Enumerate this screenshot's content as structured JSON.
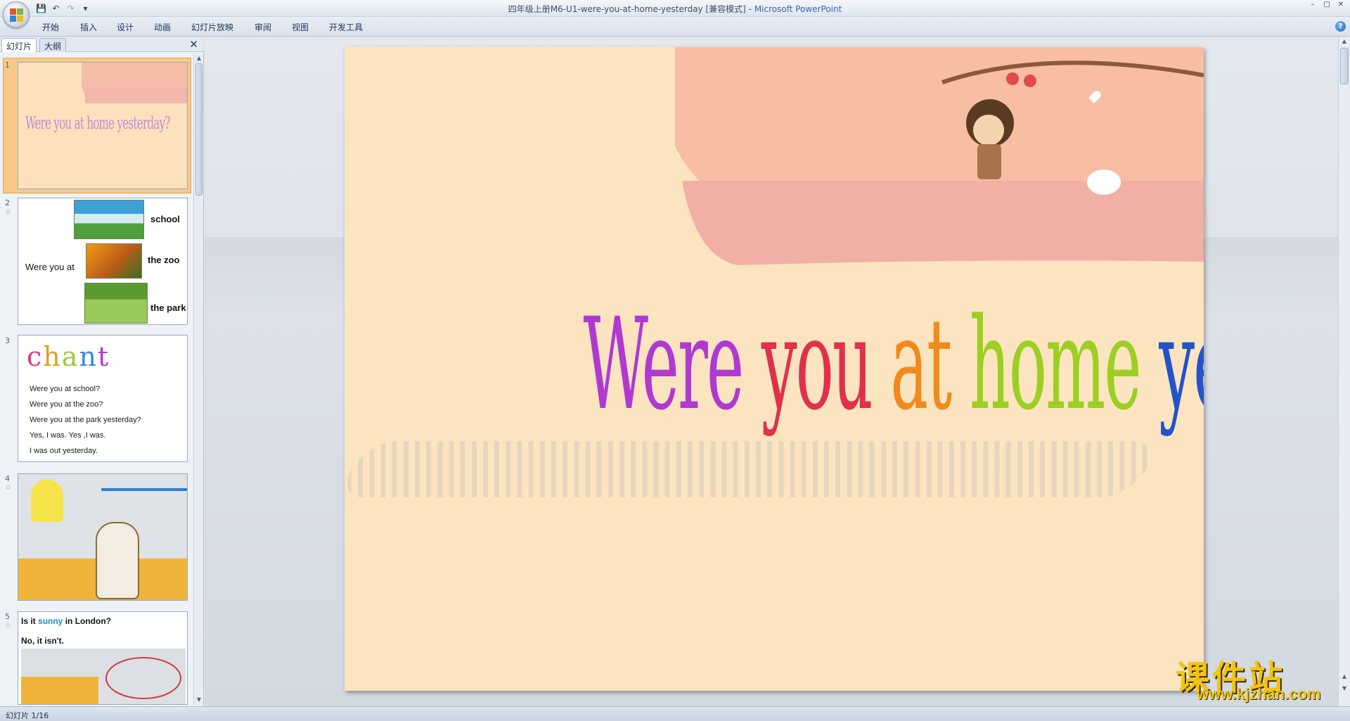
{
  "window": {
    "title": "四年级上册M6-U1-were-you-at-home-yesterday [兼容模式]",
    "app_name": "Microsoft PowerPoint",
    "controls": [
      "–",
      "□",
      "✕"
    ]
  },
  "qat": {
    "save": "💾",
    "undo": "↶",
    "redo": "↷",
    "customize": "▾"
  },
  "ribbon": {
    "tabs": [
      "开始",
      "插入",
      "设计",
      "动画",
      "幻灯片放映",
      "审阅",
      "视图",
      "开发工具"
    ],
    "help": "?"
  },
  "pane": {
    "tabs": [
      "幻灯片",
      "大纲"
    ],
    "close": "✕"
  },
  "slides": [
    {
      "num": "1",
      "title": "Were you at home yesterday?"
    },
    {
      "num": "2",
      "lead": "Were you at",
      "labels": [
        "school",
        "the zoo",
        "the park"
      ]
    },
    {
      "num": "3",
      "heading": "chant",
      "lines": [
        "Were you at school?",
        "Were you at the zoo?",
        "Were you at the park yesterday?",
        "Yes, I was. Yes ,I was.",
        "I was out yesterday."
      ]
    },
    {
      "num": "4"
    },
    {
      "num": "5",
      "question_a": "Is it ",
      "question_sunny": "sunny",
      "question_b": " in London?",
      "answer": "No, it isn't."
    }
  ],
  "main_slide": {
    "title_words": [
      {
        "text": "Were",
        "color": "#b03ad0"
      },
      {
        "text": " you",
        "color": "#e0304a"
      },
      {
        "text": " at",
        "color": "#f08a1c"
      },
      {
        "text": " home",
        "color": "#9ccf22"
      },
      {
        "text": " yesterday?",
        "color": "#2353c8"
      }
    ]
  },
  "status": {
    "text": "幻灯片 1/16"
  },
  "watermark": {
    "cn": "课件站",
    "url": "www.kjzhan.com"
  }
}
